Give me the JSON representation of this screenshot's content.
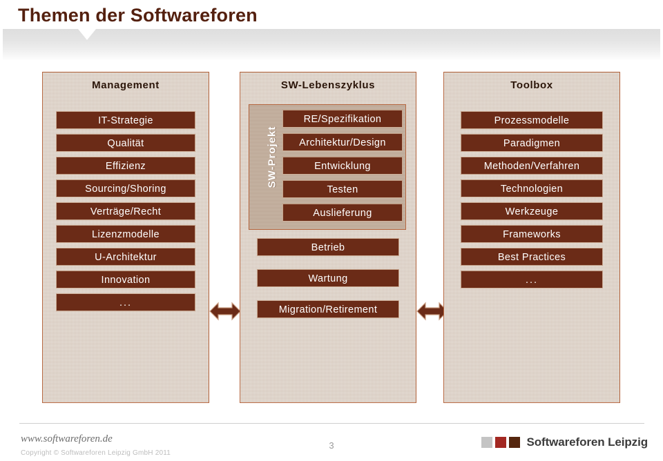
{
  "slide": {
    "title": "Themen der Softwareforen",
    "page_number": "3"
  },
  "colors": {
    "title_brown": "#54200f",
    "item_brown": "#6b2b17",
    "panel_tan": "#d9cdc1",
    "panel_border": "#b5663f",
    "swprojekt_tan": "#c0ab99",
    "logo_gray": "#c4c4c4",
    "logo_red": "#a32822",
    "logo_brown": "#55260e"
  },
  "columns": {
    "management": {
      "header": "Management",
      "items": [
        "IT-Strategie",
        "Qualität",
        "Effizienz",
        "Sourcing/Shoring",
        "Verträge/Recht",
        "Lizenzmodelle",
        "U-Architektur",
        "Innovation",
        "..."
      ]
    },
    "lifecycle": {
      "header": "SW-Lebenszyklus",
      "group_label": "SW-Projekt",
      "group_items": [
        "RE/Spezifikation",
        "Architektur/Design",
        "Entwicklung",
        "Testen",
        "Auslieferung"
      ],
      "tail_items": [
        "Betrieb",
        "Wartung",
        "Migration/Retirement"
      ]
    },
    "toolbox": {
      "header": "Toolbox",
      "items": [
        "Prozessmodelle",
        "Paradigmen",
        "Methoden/Verfahren",
        "Technologien",
        "Werkzeuge",
        "Frameworks",
        "Best Practices",
        "..."
      ]
    }
  },
  "connectors": {
    "left_arrow": "double-arrow-horizontal",
    "right_arrow": "double-arrow-horizontal"
  },
  "footer": {
    "url": "www.softwareforen.de",
    "copyright": "Copyright © Softwareforen Leipzig GmbH 2011",
    "logo_text": "Softwareforen Leipzig"
  }
}
